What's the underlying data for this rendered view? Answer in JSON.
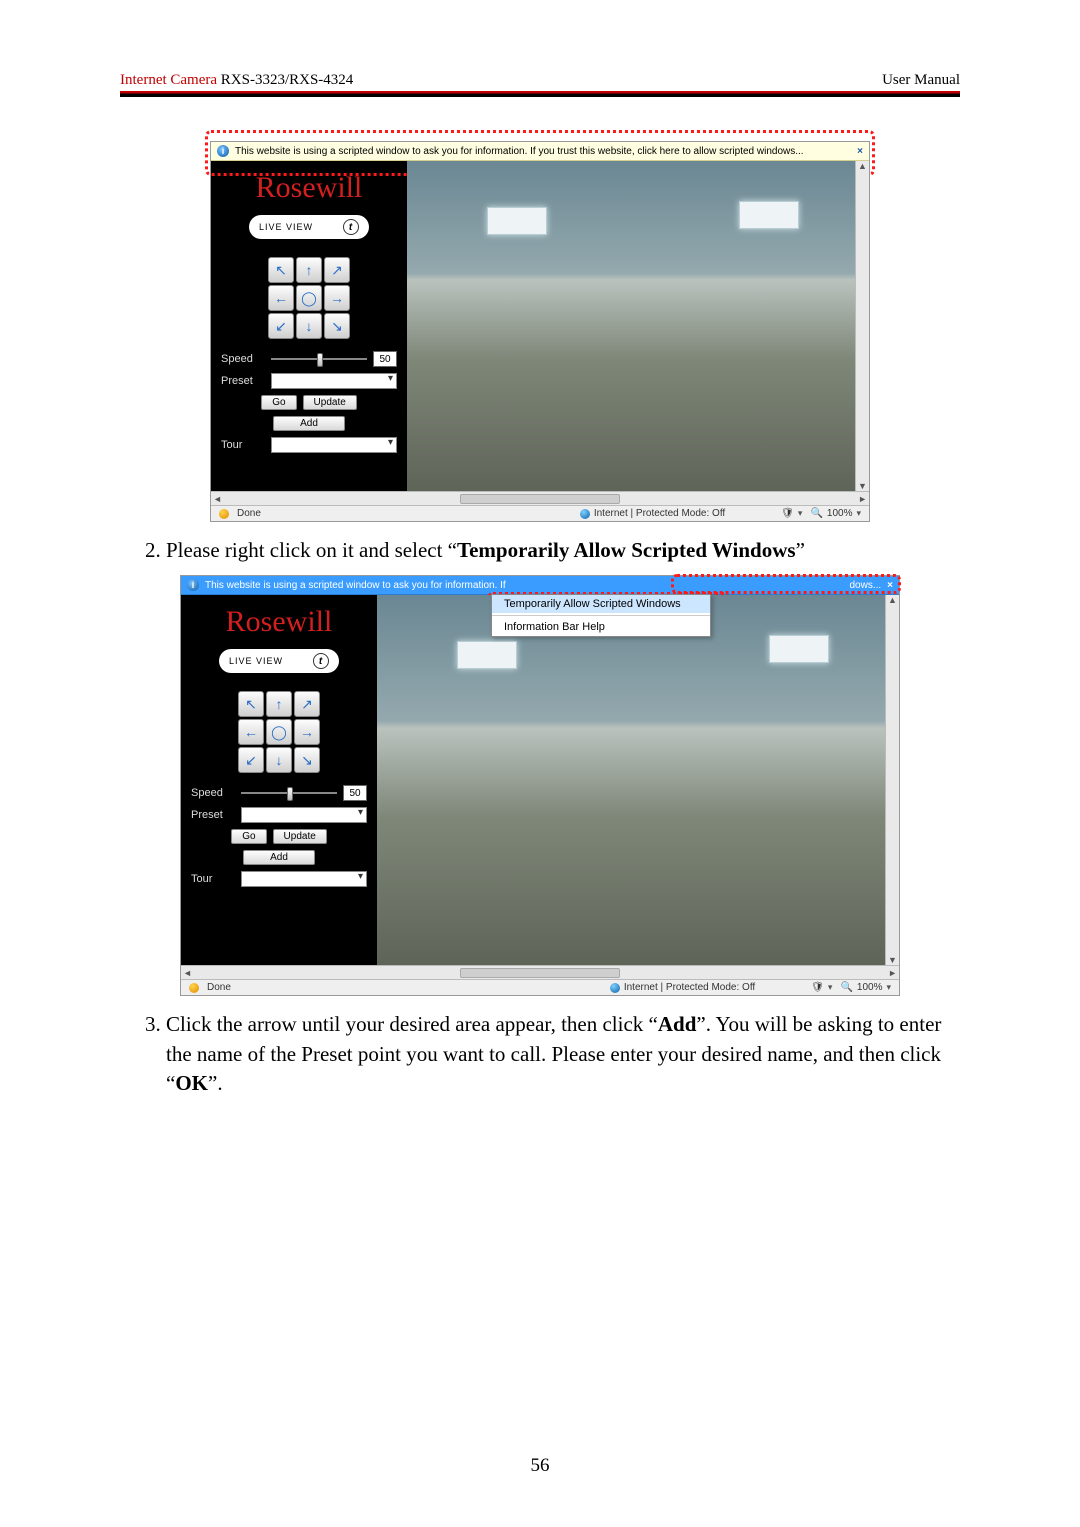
{
  "header": {
    "product_prefix": "Internet Camera ",
    "product_models": "RXS-3323/RXS-4324",
    "right": "User Manual"
  },
  "page_number": "56",
  "infobar_text_full": "This website is using a scripted window to ask you for information. If you trust this website, click here to allow scripted windows...",
  "infobar_text_trunc": "This website is using a scripted window to ask you for information. If",
  "infobar_trailing": "dows...",
  "context_menu": {
    "item1": "Temporarily Allow Scripted Windows",
    "item2": "Information Bar Help"
  },
  "sidebar": {
    "brand": "Rosewill",
    "live_view": "LIVE VIEW",
    "speed_label": "Speed",
    "speed_value": "50",
    "preset_label": "Preset",
    "go_btn": "Go",
    "update_btn": "Update",
    "add_btn": "Add",
    "tour_label": "Tour"
  },
  "statusbar": {
    "done": "Done",
    "zone": "Internet | Protected Mode: Off",
    "zoom": "100%"
  },
  "steps": {
    "s2_pre": "Please right click on it and select “",
    "s2_bold": "Temporarily Allow Scripted Windows",
    "s2_post": "”",
    "s3_a": "Click the arrow until your desired area appear, then click “",
    "s3_add": "Add",
    "s3_b": "”. You will be asking to enter the name of the Preset point you want to call. Please enter your desired name, and then click “",
    "s3_ok": "OK",
    "s3_c": "”."
  }
}
